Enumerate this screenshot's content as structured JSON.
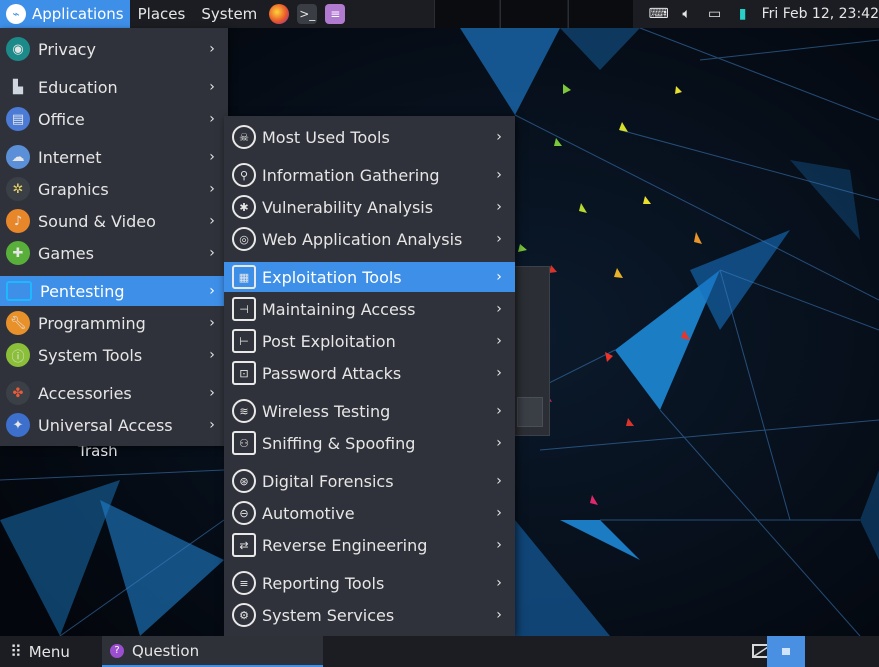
{
  "topbar": {
    "applications_label": "Applications",
    "places_label": "Places",
    "system_label": "System",
    "clock": "Fri Feb 12, 23:42"
  },
  "main_menu": [
    {
      "label": "Privacy",
      "icon": "privacy-icon",
      "color": "#1d8a8a"
    },
    {
      "label": "Education",
      "icon": "education-icon",
      "color": "#4a5566"
    },
    {
      "label": "Office",
      "icon": "office-icon",
      "color": "#4b7bd6"
    },
    {
      "label": "Internet",
      "icon": "internet-icon",
      "color": "#5b8fd8"
    },
    {
      "label": "Graphics",
      "icon": "graphics-icon",
      "color": "#3b3f46"
    },
    {
      "label": "Sound & Video",
      "icon": "sound-video-icon",
      "color": "#e8872a"
    },
    {
      "label": "Games",
      "icon": "games-icon",
      "color": "#58b03a"
    },
    {
      "label": "Pentesting",
      "icon": "pentesting-icon",
      "color": "#27a6e0"
    },
    {
      "label": "Programming",
      "icon": "programming-icon",
      "color": "#e8912a"
    },
    {
      "label": "System Tools",
      "icon": "system-tools-icon",
      "color": "#8bbf3a"
    },
    {
      "label": "Accessories",
      "icon": "accessories-icon",
      "color": "#3b3f46"
    },
    {
      "label": "Universal Access",
      "icon": "universal-access-icon",
      "color": "#3d6fcc"
    }
  ],
  "sub_menu": [
    {
      "label": "Most Used Tools",
      "icon": "skull-icon"
    },
    {
      "label": "Information Gathering",
      "icon": "magnifier-icon"
    },
    {
      "label": "Vulnerability Analysis",
      "icon": "bug-icon"
    },
    {
      "label": "Web Application Analysis",
      "icon": "web-icon"
    },
    {
      "label": "Exploitation Tools",
      "icon": "exploit-icon"
    },
    {
      "label": "Maintaining Access",
      "icon": "access-icon"
    },
    {
      "label": "Post Exploitation",
      "icon": "post-exploit-icon"
    },
    {
      "label": "Password Attacks",
      "icon": "password-icon"
    },
    {
      "label": "Wireless Testing",
      "icon": "wifi-icon"
    },
    {
      "label": "Sniffing & Spoofing",
      "icon": "sniff-icon"
    },
    {
      "label": "Digital Forensics",
      "icon": "forensics-icon"
    },
    {
      "label": "Automotive",
      "icon": "car-icon"
    },
    {
      "label": "Reverse Engineering",
      "icon": "reverse-icon"
    },
    {
      "label": "Reporting Tools",
      "icon": "report-icon"
    },
    {
      "label": "System Services",
      "icon": "services-icon"
    }
  ],
  "desktop": {
    "trash_label": "Trash"
  },
  "bottombar": {
    "menu_label": "Menu",
    "task_label": "Question"
  },
  "accent": "#3e8fe8"
}
